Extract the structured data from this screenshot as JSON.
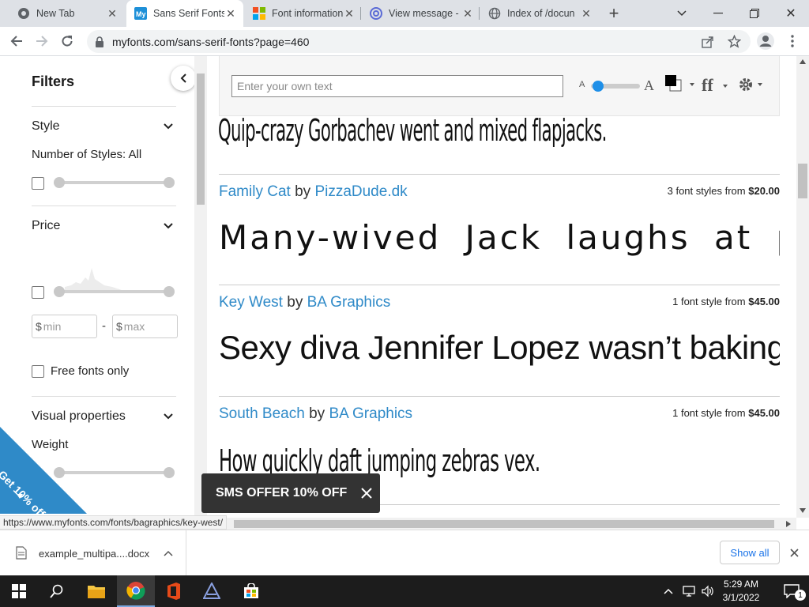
{
  "tabs": [
    {
      "title": "New Tab",
      "icon": "chrome-icon"
    },
    {
      "title": "Sans Serif Fonts",
      "icon": "myfonts-icon",
      "active": true
    },
    {
      "title": "Font information",
      "icon": "microsoft-icon"
    },
    {
      "title": "View message -",
      "icon": "at-sign-icon"
    },
    {
      "title": "Index of /docun",
      "icon": "globe-icon"
    }
  ],
  "address": {
    "url": "myfonts.com/sans-serif-fonts?page=460"
  },
  "sidebar": {
    "title": "Filters",
    "style": {
      "heading": "Style",
      "num_styles": "Number of Styles: All"
    },
    "price": {
      "heading": "Price",
      "min_currency": "$",
      "min_placeholder": "min",
      "dash": "-",
      "max_currency": "$",
      "max_placeholder": "max"
    },
    "free_only": "Free fonts only",
    "visual": {
      "heading": "Visual properties",
      "weight": "Weight"
    },
    "promo": "Get 10% off!"
  },
  "toolbar": {
    "text_placeholder": "Enter your own text",
    "size_small": "A",
    "size_large": "A",
    "size_fraction": 0.05
  },
  "fonts": [
    {
      "sample": "Quip-crazy Gorbachev went and mixed flapjacks."
    },
    {
      "name": "Family Cat",
      "by": "by",
      "foundry": "PizzaDude.dk",
      "styles": "3 font styles from",
      "price": "$20.00",
      "sample": "Many-wived Jack laughs at probes"
    },
    {
      "name": "Key West",
      "by": "by",
      "foundry": "BA Graphics",
      "styles": "1 font style from",
      "price": "$45.00",
      "sample": "Sexy diva Jennifer Lopez wasn’t baking my"
    },
    {
      "name": "South Beach",
      "by": "by",
      "foundry": "BA Graphics",
      "styles": "1 font style from",
      "price": "$45.00",
      "sample": "How quickly daft jumping zebras vex."
    }
  ],
  "status_url": "https://www.myfonts.com/fonts/bagraphics/key-west/",
  "toast": {
    "text": "SMS OFFER 10% OFF"
  },
  "download": {
    "filename": "example_multipa....docx",
    "show_all": "Show all"
  },
  "taskbar": {
    "time": "5:29 AM",
    "date": "3/1/2022",
    "notifications": "1"
  }
}
